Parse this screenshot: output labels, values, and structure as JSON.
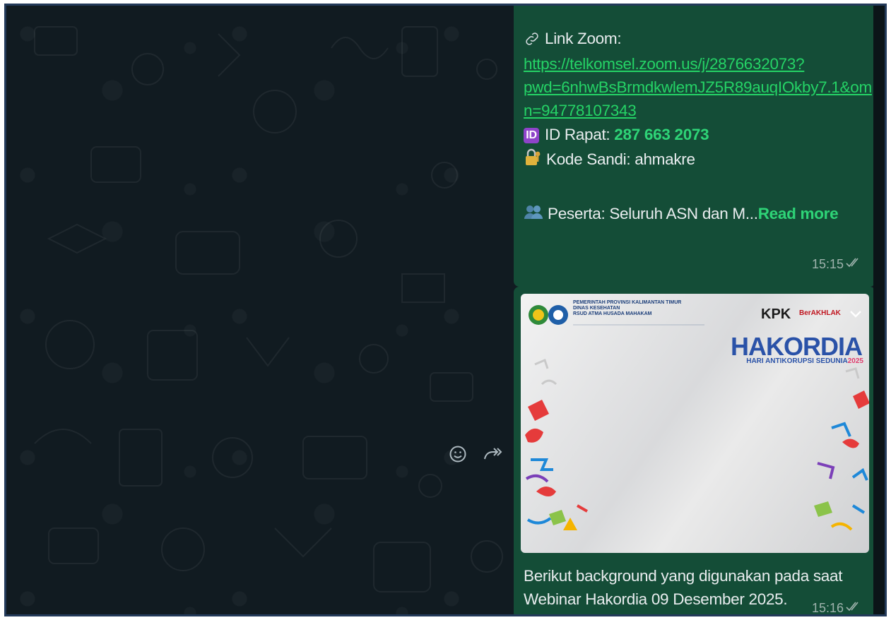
{
  "message1": {
    "link_label": "Link Zoom:",
    "link_lines": [
      "https://telkomsel.zoom.us/j/2876632073?",
      "pwd=6nhwBsBrmdkwlemJZ5R89auqIOkby7.1&om",
      "n=94778107343"
    ],
    "id_label": "ID Rapat:",
    "id_value": "287 663 2073",
    "password_label": "Kode Sandi: ahmakre",
    "participants_text": "Peserta: Seluruh ASN dan M...",
    "read_more": "Read more",
    "time": "15:15"
  },
  "message2": {
    "poster": {
      "header_lines": [
        "PEMERINTAH PROVINSI KALIMANTAN TIMUR",
        "DINAS KESEHATAN",
        "RSUD ATMA HUSADA MAHAKAM"
      ],
      "kpk": "KPK",
      "berakhlak": "BerAKHLAK",
      "title": "HAKORDIA",
      "subtitle": "HARI ANTIKORUPSI SEDUNIA",
      "year": "2025"
    },
    "caption_lines": [
      "Berikut background yang digunakan pada saat",
      "Webinar Hakordia 09 Desember 2025."
    ],
    "time": "15:16"
  },
  "icons": {
    "emoji_button": "smiley-icon",
    "forward_button": "forward-icon"
  },
  "colors": {
    "bubble": "#144d37",
    "link": "#25d366",
    "background": "#111b21"
  }
}
